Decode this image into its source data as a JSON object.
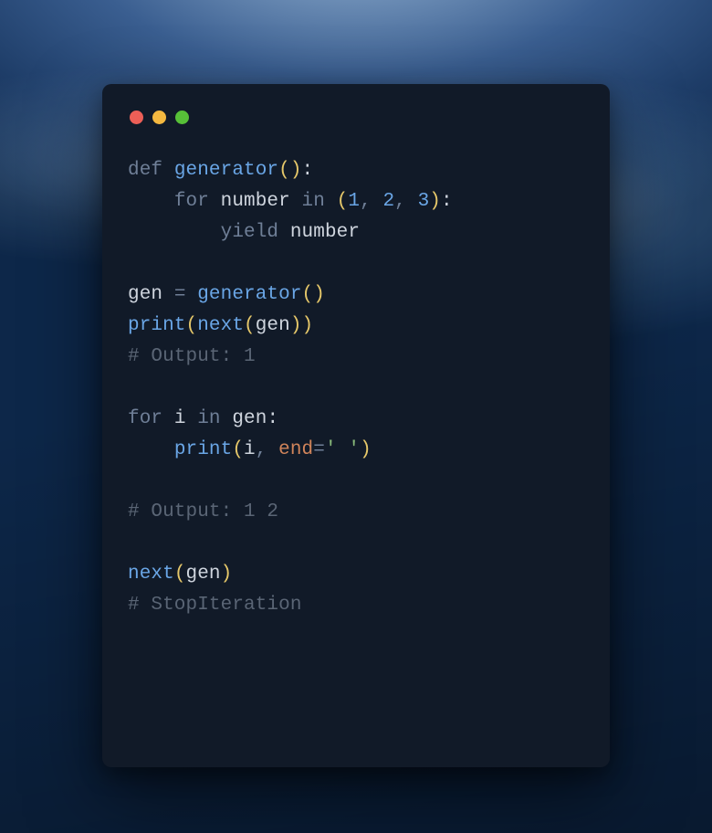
{
  "window": {
    "traffic_lights": {
      "close_color": "#ec5f57",
      "min_color": "#f4b840",
      "max_color": "#57c038"
    }
  },
  "code": {
    "l1": {
      "kw_def": "def ",
      "fn": "generator",
      "popen": "(",
      "pclose": ")",
      "colon": ":"
    },
    "l2": {
      "indent": "    ",
      "kw_for": "for ",
      "id": "number",
      "kw_in": " in ",
      "popen": "(",
      "n1": "1",
      "c1": ", ",
      "n2": "2",
      "c2": ", ",
      "n3": "3",
      "pclose": ")",
      "colon": ":"
    },
    "l3": {
      "indent": "        ",
      "kw_yield": "yield ",
      "id": "number"
    },
    "l5": {
      "id_gen": "gen",
      "sp": " ",
      "op_eq": "=",
      "sp2": " ",
      "fn": "generator",
      "popen": "(",
      "pclose": ")"
    },
    "l6": {
      "fn_print": "print",
      "popen": "(",
      "fn_next": "next",
      "popen2": "(",
      "id_gen": "gen",
      "pclose2": ")",
      "pclose": ")"
    },
    "l7": {
      "cmt": "# Output: 1"
    },
    "l9": {
      "kw_for": "for ",
      "id_i": "i",
      "kw_in": " in ",
      "id_gen": "gen",
      "colon": ":"
    },
    "l10": {
      "indent": "    ",
      "fn_print": "print",
      "popen": "(",
      "id_i": "i",
      "comma": ", ",
      "kwarg": "end",
      "op_eq": "=",
      "str": "' '",
      "pclose": ")"
    },
    "l12": {
      "cmt": "# Output: 1 2"
    },
    "l14": {
      "fn_next": "next",
      "popen": "(",
      "id_gen": "gen",
      "pclose": ")"
    },
    "l15": {
      "cmt": "# StopIteration"
    }
  }
}
